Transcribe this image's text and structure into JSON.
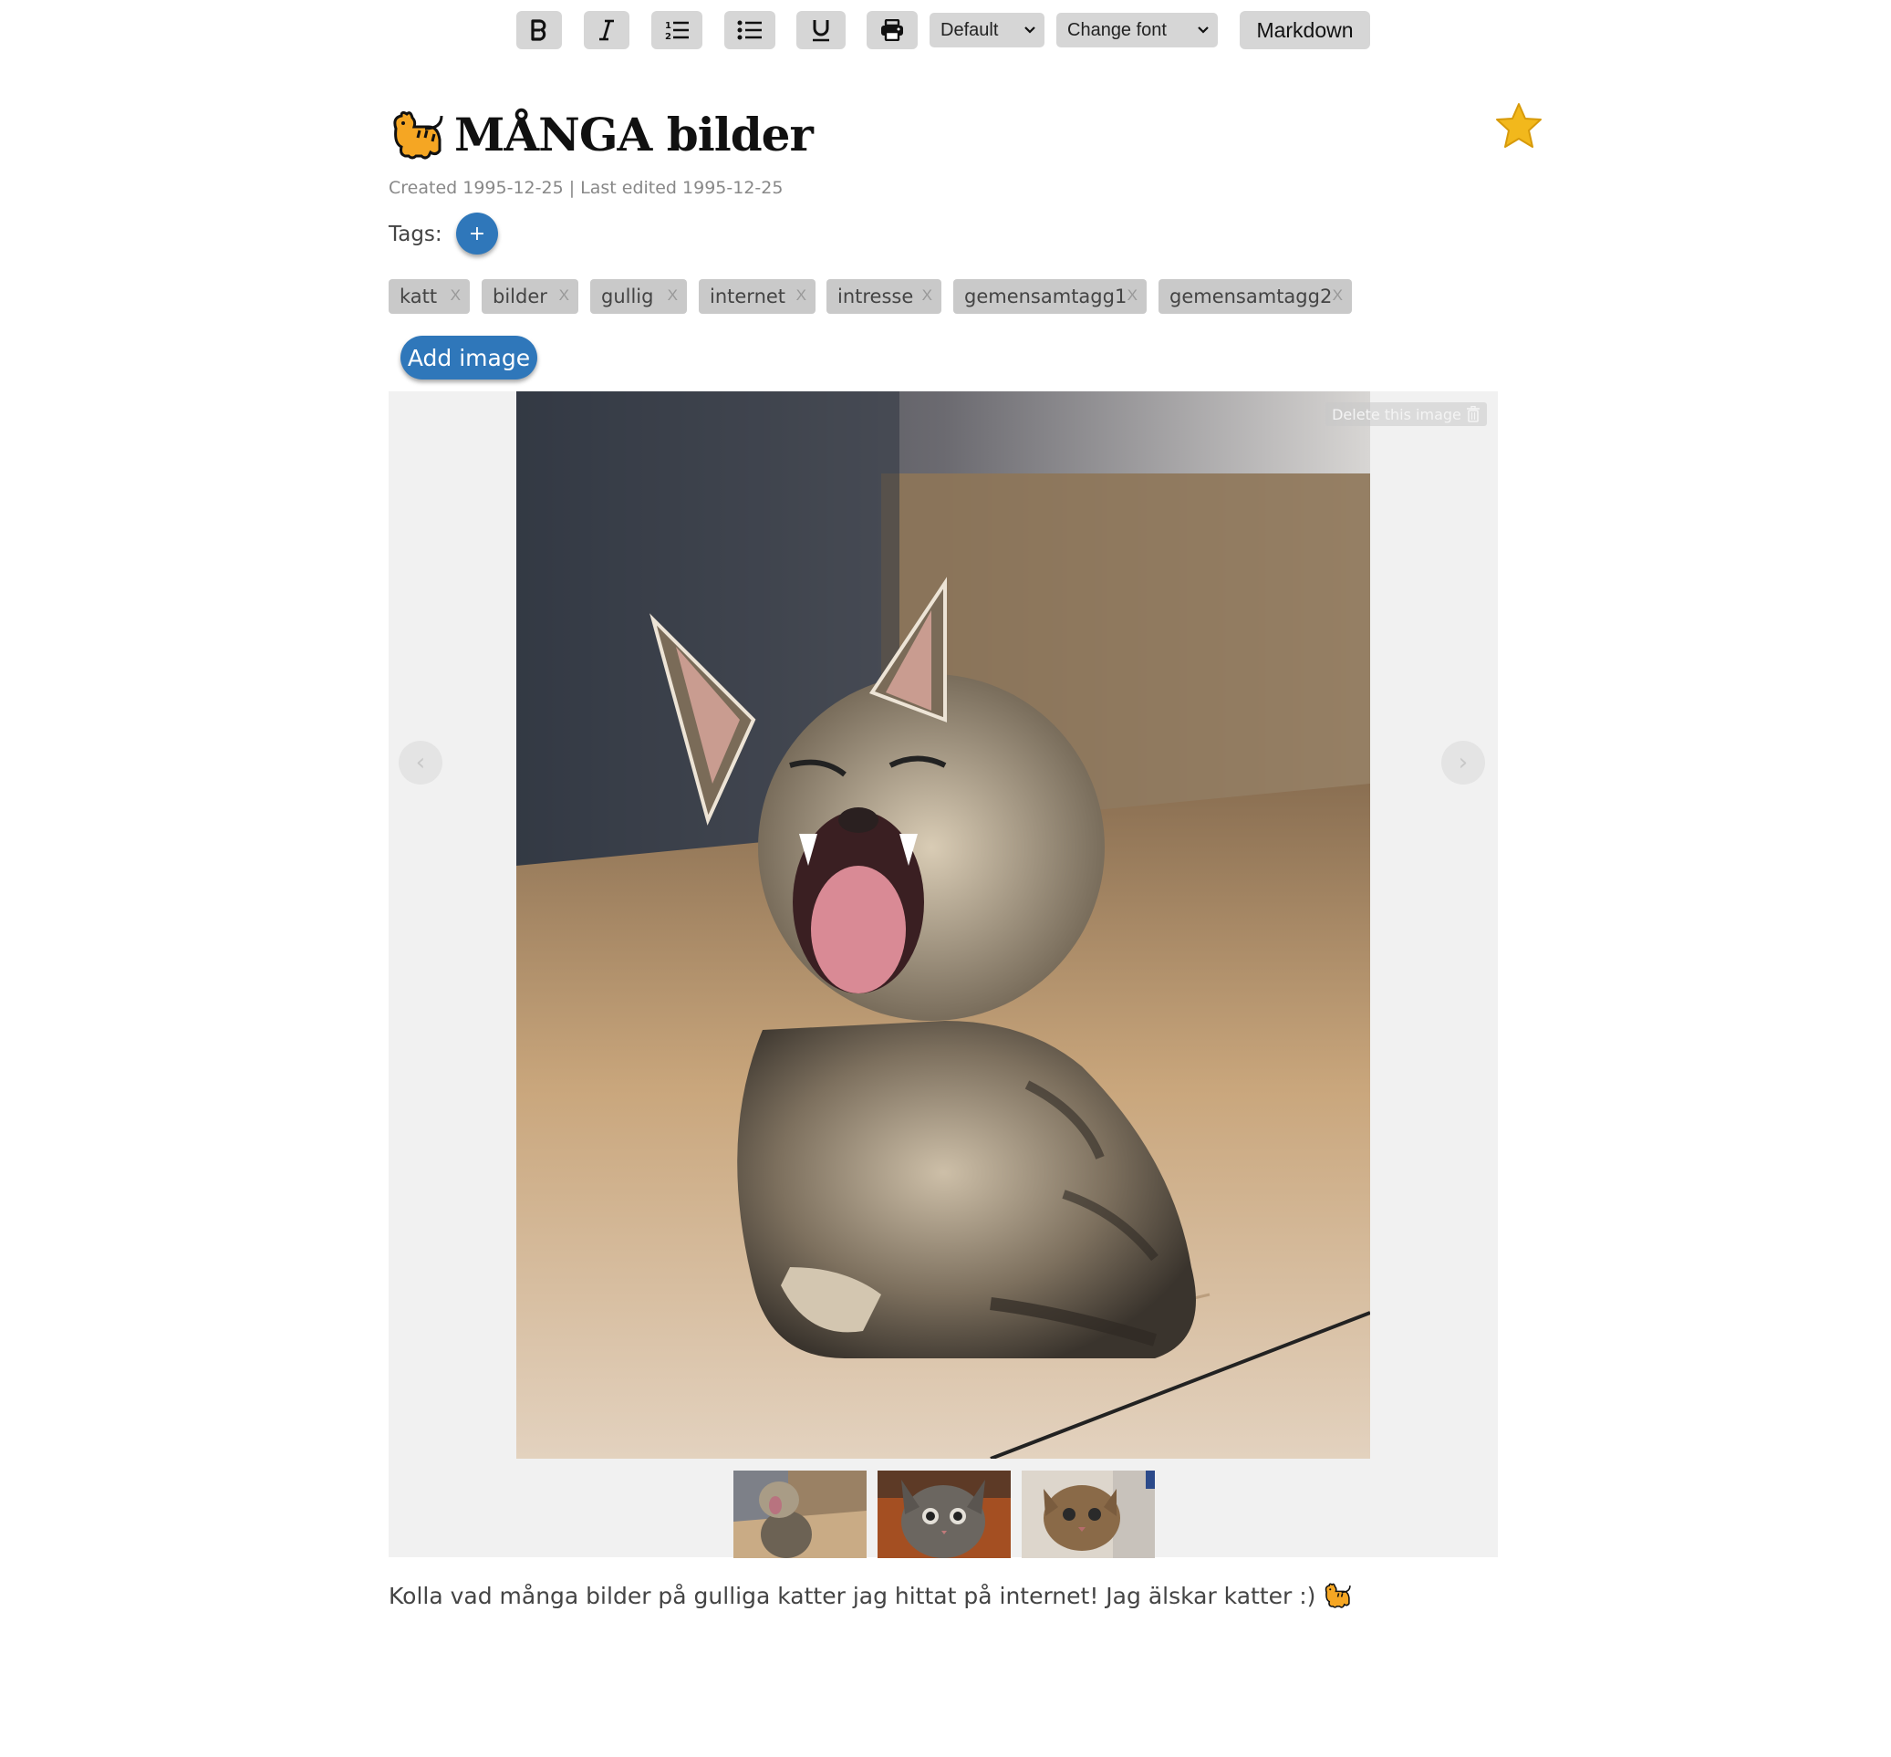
{
  "toolbar": {
    "bold_icon": "bold-icon",
    "italic_icon": "italic-icon",
    "ordered_list_icon": "ordered-list-icon",
    "unordered_list_icon": "unordered-list-icon",
    "underline_icon": "underline-icon",
    "print_icon": "print-icon",
    "size_select": {
      "value": "Default"
    },
    "font_select": {
      "value": "Change font"
    },
    "markdown_label": "Markdown"
  },
  "note": {
    "title": "MÅNGA bilder",
    "title_icon": "cat-emoji-icon",
    "favorite_icon": "star-icon",
    "meta": "Created 1995-12-25 | Last edited 1995-12-25",
    "tags_label": "Tags:",
    "add_tag_label": "+",
    "tags": [
      {
        "label": "katt",
        "remove": "X"
      },
      {
        "label": "bilder",
        "remove": "X"
      },
      {
        "label": "gullig",
        "remove": "X"
      },
      {
        "label": "internet",
        "remove": "X"
      },
      {
        "label": "intresse",
        "remove": "X"
      },
      {
        "label": "gemensamtagg1",
        "remove": "X"
      },
      {
        "label": "gemensamtagg2",
        "remove": "X"
      }
    ],
    "add_image_label": "Add image",
    "body": "Kolla vad många bilder på gulliga katter jag hittat på internet! Jag älskar katter :)"
  },
  "gallery": {
    "delete_label": "Delete this image",
    "prev_label": "‹",
    "next_label": "›",
    "main_image": "yawning-kitten-photo",
    "thumbnails": [
      "yawning-kitten-thumb",
      "tabby-kitten-thumb",
      "wet-kitten-thumb"
    ]
  },
  "colors": {
    "accent": "#2f77ba",
    "toolbar_button": "#d6d6d6",
    "tag_bg": "#c9c9c9",
    "gallery_bg": "#f1f1f1",
    "star": "#f2b81c"
  }
}
